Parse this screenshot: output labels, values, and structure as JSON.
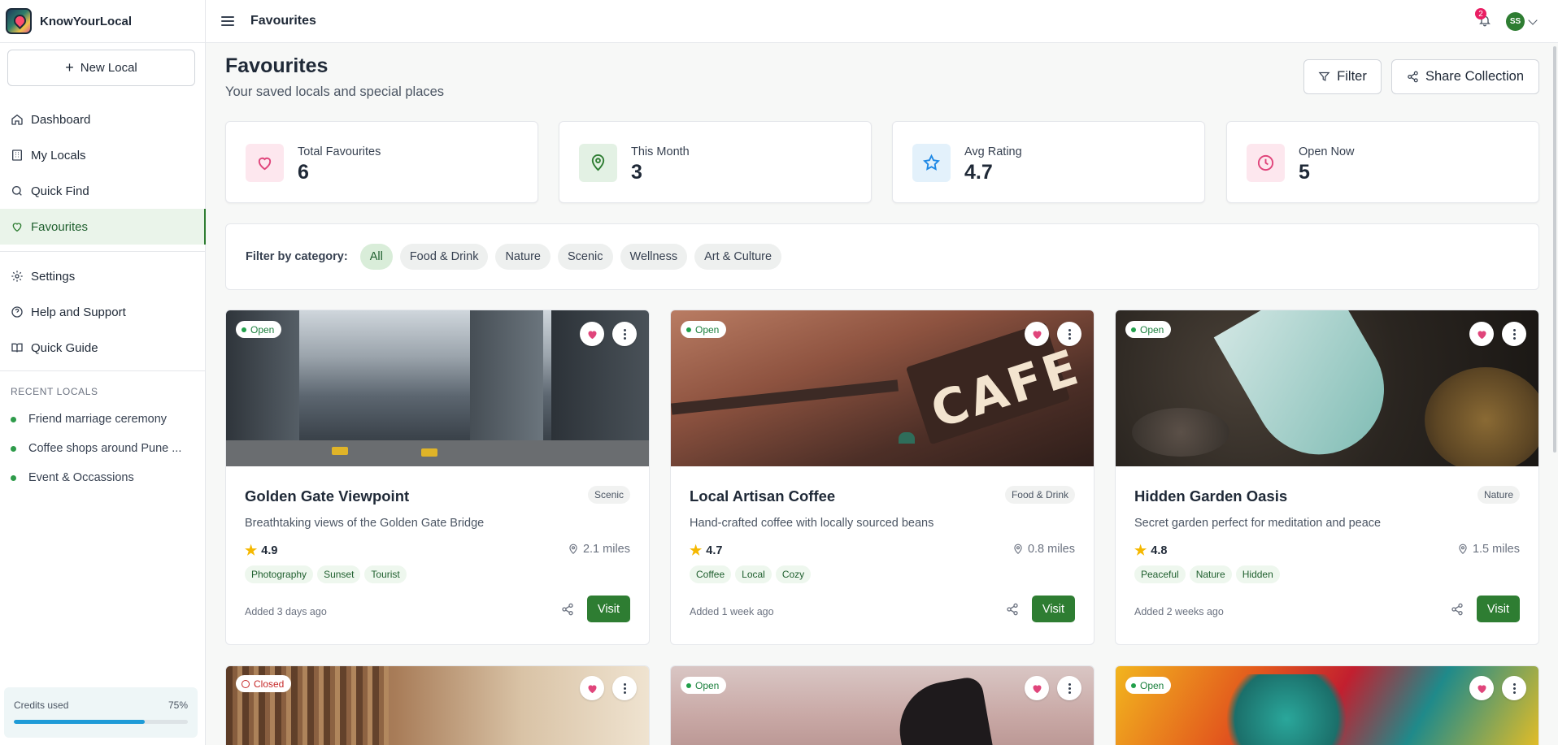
{
  "app": {
    "name": "KnowYourLocal"
  },
  "sidebar": {
    "new_local_label": "New Local",
    "nav": [
      {
        "label": "Dashboard",
        "icon": "home-icon"
      },
      {
        "label": "My Locals",
        "icon": "building-icon"
      },
      {
        "label": "Quick Find",
        "icon": "search-icon"
      },
      {
        "label": "Favourites",
        "icon": "heart-icon",
        "active": true
      }
    ],
    "nav2": [
      {
        "label": "Settings",
        "icon": "gear-icon"
      },
      {
        "label": "Help and Support",
        "icon": "help-circle-icon"
      },
      {
        "label": "Quick Guide",
        "icon": "book-icon"
      }
    ],
    "recent_title": "RECENT LOCALS",
    "recent": [
      {
        "label": "Friend marriage ceremony"
      },
      {
        "label": "Coffee shops around Pune ..."
      },
      {
        "label": "Event & Occassions"
      }
    ],
    "credits": {
      "label": "Credits used",
      "percent_label": "75%",
      "fraction": 0.75,
      "color": "#1e9bd7"
    }
  },
  "topbar": {
    "title": "Favourites",
    "notification_count": "2",
    "avatar_initials": "SS"
  },
  "header": {
    "title": "Favourites",
    "subtitle": "Your saved locals and special places",
    "filter_label": "Filter",
    "share_label": "Share Collection"
  },
  "stats": [
    {
      "label": "Total Favourites",
      "value": "6",
      "icon": "heart-icon",
      "bg": "#fde7ee",
      "color": "#e0457b"
    },
    {
      "label": "This Month",
      "value": "3",
      "icon": "map-pin-icon",
      "bg": "#e3f1e4",
      "color": "#2e7d32"
    },
    {
      "label": "Avg Rating",
      "value": "4.7",
      "icon": "star-icon",
      "bg": "#e3f1fb",
      "color": "#1e88e5"
    },
    {
      "label": "Open Now",
      "value": "5",
      "icon": "clock-icon",
      "bg": "#fde7ee",
      "color": "#e0457b"
    }
  ],
  "filters": {
    "label": "Filter by category:",
    "categories": [
      "All",
      "Food & Drink",
      "Nature",
      "Scenic",
      "Wellness",
      "Art & Culture"
    ],
    "selected": "All"
  },
  "cards": [
    {
      "status": "Open",
      "title": "Golden Gate Viewpoint",
      "category": "Scenic",
      "description": "Breathtaking views of the Golden Gate Bridge",
      "rating": "4.9",
      "distance": "2.1 miles",
      "tags": [
        "Photography",
        "Sunset",
        "Tourist"
      ],
      "added": "Added 3 days ago",
      "visit_label": "Visit"
    },
    {
      "status": "Open",
      "title": "Local Artisan Coffee",
      "category": "Food & Drink",
      "description": "Hand-crafted coffee with locally sourced beans",
      "rating": "4.7",
      "distance": "0.8 miles",
      "tags": [
        "Coffee",
        "Local",
        "Cozy"
      ],
      "added": "Added 1 week ago",
      "visit_label": "Visit"
    },
    {
      "status": "Open",
      "title": "Hidden Garden Oasis",
      "category": "Nature",
      "description": "Secret garden perfect for meditation and peace",
      "rating": "4.8",
      "distance": "1.5 miles",
      "tags": [
        "Peaceful",
        "Nature",
        "Hidden"
      ],
      "added": "Added 2 weeks ago",
      "visit_label": "Visit"
    },
    {
      "status": "Closed"
    },
    {
      "status": "Open"
    },
    {
      "status": "Open"
    }
  ]
}
